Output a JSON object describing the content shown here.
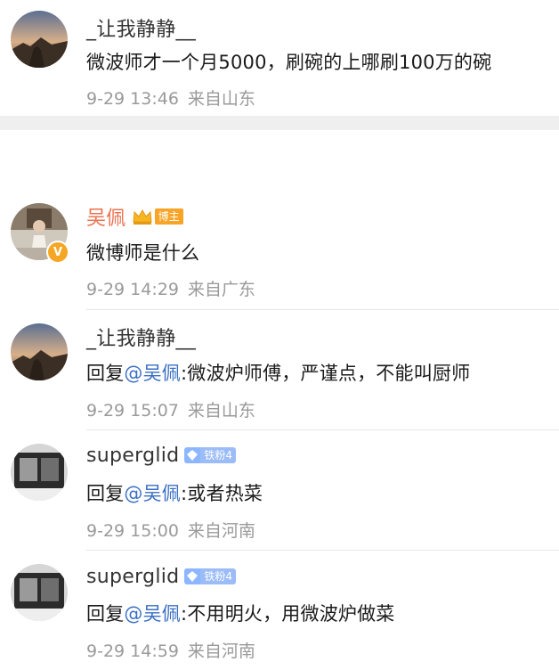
{
  "comments": [
    {
      "name": "_让我静静__",
      "text": "微波师才一个月5000，刷碗的上哪刷100万的碗",
      "time": "9-29 13:46",
      "location": "来自山东"
    },
    {
      "name": "吴佩",
      "badge": "博主",
      "text": "微博师是什么",
      "time": "9-29 14:29",
      "location": "来自广东"
    },
    {
      "name": "_让我静静__",
      "reply_prefix": "回复",
      "mention": "@吴佩",
      "text": ":微波炉师傅，严谨点，不能叫厨师",
      "time": "9-29 15:07",
      "location": "来自山东"
    },
    {
      "name": "superglid",
      "badge": "铁粉4",
      "reply_prefix": "回复",
      "mention": "@吴佩",
      "text": ":或者热菜",
      "time": "9-29 15:00",
      "location": "来自河南"
    },
    {
      "name": "superglid",
      "badge": "铁粉4",
      "reply_prefix": "回复",
      "mention": "@吴佩",
      "text": ":不用明火，用微波炉做菜",
      "time": "9-29 14:59",
      "location": "来自河南"
    }
  ],
  "icons": {
    "crown": "crown-icon",
    "verified": "verified-v-icon",
    "fan": "diamond-icon"
  },
  "colors": {
    "highlight_name": "#eb7350",
    "mention": "#3a6fc4",
    "meta": "#9a9a9a",
    "boss_tag": "#f7a427",
    "fan_tag": "#9bbcf7"
  }
}
